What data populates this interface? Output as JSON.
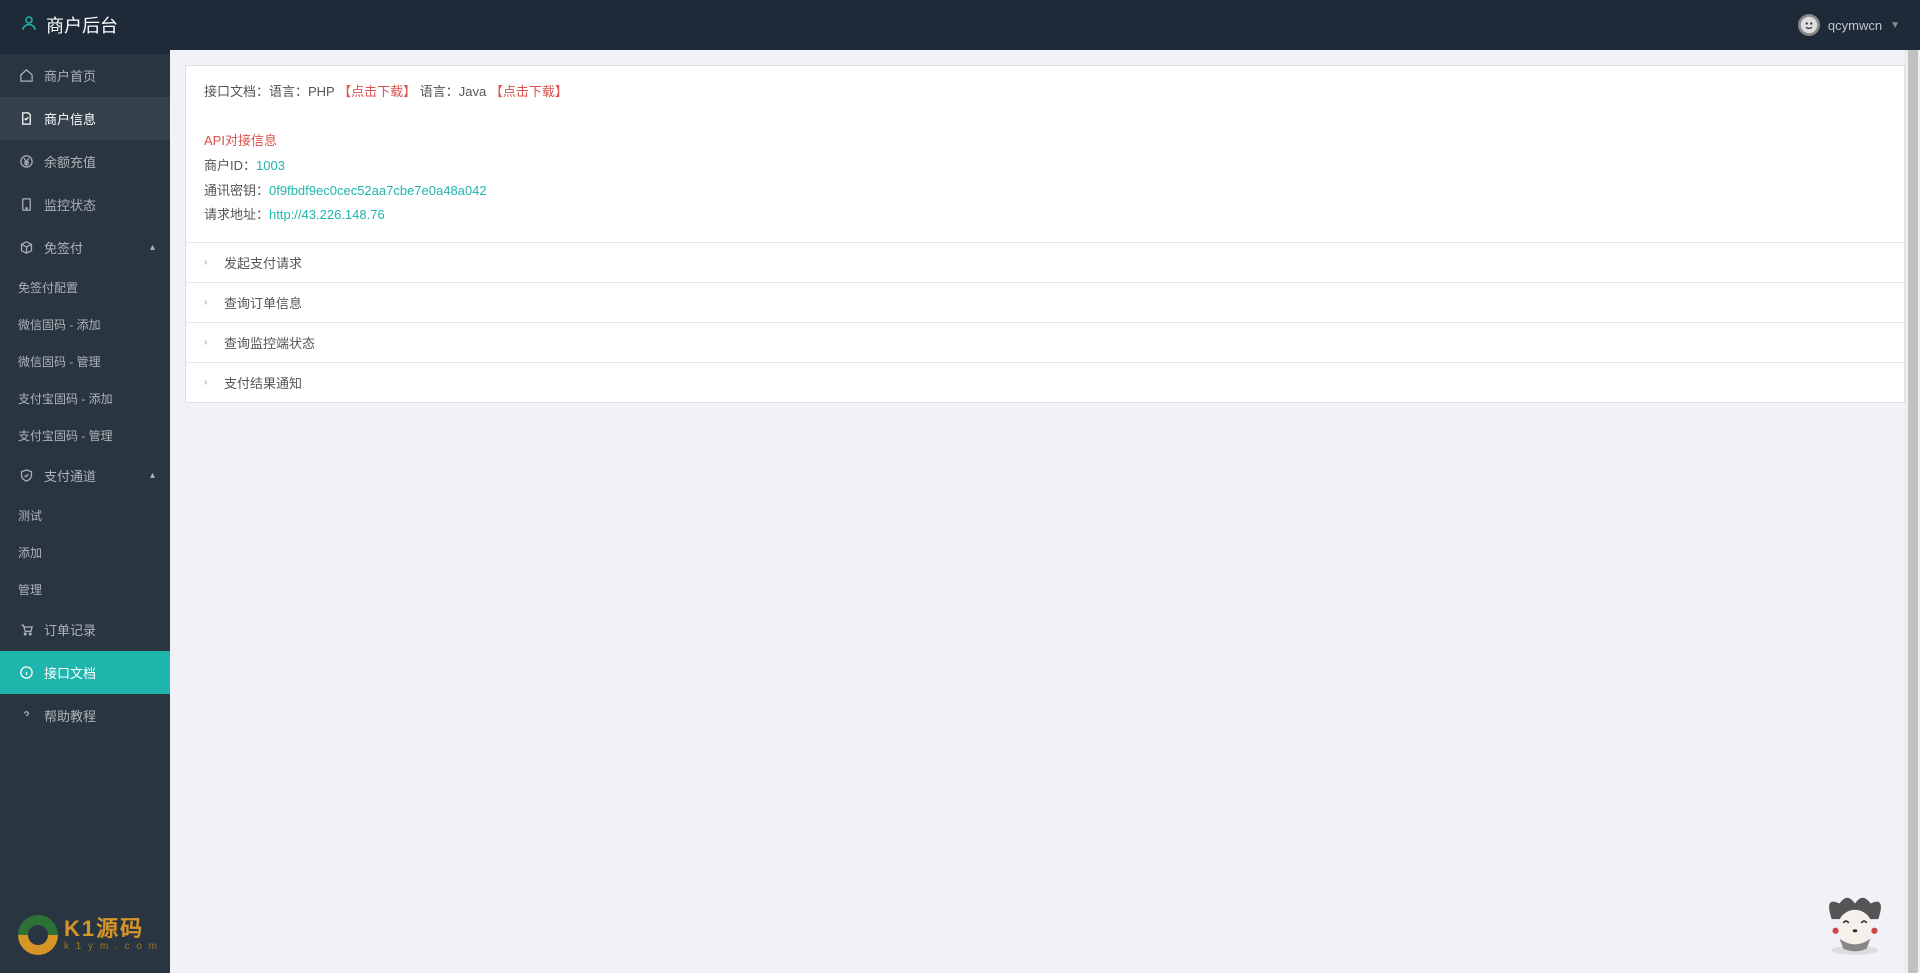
{
  "header": {
    "title": "商户后台",
    "username": "qcymwcn"
  },
  "sidebar": {
    "home": "商户首页",
    "merchant_info": "商户信息",
    "balance_recharge": "余额充值",
    "monitor_status": "监控状态",
    "free_sign": "免签付",
    "free_sign_sub": {
      "config": "免签付配置",
      "wx_fixed_add": "微信固码 - 添加",
      "wx_fixed_manage": "微信固码 - 管理",
      "ali_fixed_add": "支付宝固码 - 添加",
      "ali_fixed_manage": "支付宝固码 - 管理"
    },
    "pay_channel": "支付通道",
    "pay_channel_sub": {
      "test": "测试",
      "add": "添加",
      "manage": "管理"
    },
    "order_record": "订单记录",
    "api_doc": "接口文档",
    "help_tutorial": "帮助教程"
  },
  "content": {
    "doc_prefix": "接口文档：语言：PHP",
    "download1": "【点击下载】",
    "lang_java": "语言：Java",
    "download2": "【点击下载】",
    "api_info_title": "API对接信息",
    "merchant_id_label": "商户ID：",
    "merchant_id_value": "1003",
    "secret_label": "通讯密钥：",
    "secret_value": "0f9fbdf9ec0cec52aa7cbe7e0a48a042",
    "request_url_label": "请求地址：",
    "request_url_value": "http://43.226.148.76"
  },
  "accordion": {
    "item1": "发起支付请求",
    "item2": "查询订单信息",
    "item3": "查询监控端状态",
    "item4": "支付结果通知"
  },
  "watermark": {
    "line1": "K1源码",
    "line2": "k 1 y m . c o m"
  }
}
